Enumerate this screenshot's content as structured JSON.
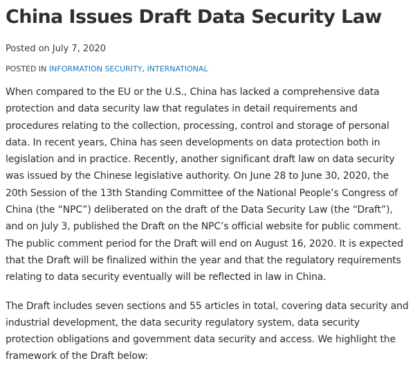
{
  "article": {
    "title": "China Issues Draft Data Security Law",
    "posted_on": "Posted on July 7, 2020",
    "posted_in_prefix": "POSTED IN ",
    "categories": [
      {
        "label": "INFORMATION SECURITY"
      },
      {
        "label": "INTERNATIONAL"
      }
    ],
    "category_separator": ", ",
    "paragraphs": [
      "When compared to the EU or the U.S., China has lacked a comprehensive data protection and data security law that regulates in detail requirements and procedures relating to the collection, processing, control and storage of personal data. In recent years, China has seen developments on data protection both in legislation and in practice. Recently, another significant draft law on data security was issued by the Chinese legislative authority. On June 28 to June 30, 2020, the 20th Session of the 13th Standing Committee of the National People’s Congress of China (the “NPC”) deliberated on the draft of the Data Security Law (the “Draft”), and on July 3, published the Draft on the NPC’s official website for public comment. The public comment period for the Draft will end on August 16, 2020. It is expected that the Draft will be finalized within the year and that the regulatory requirements relating to data security eventually will be reflected in law in China.",
      "The Draft includes seven sections and 55 articles in total, covering data security and industrial development, the data security regulatory system, data security protection obligations and government data security and access. We highlight the framework of the Draft below:"
    ]
  },
  "colors": {
    "link": "#1a77b8",
    "text": "#2b2b2b",
    "background": "#ffffff"
  }
}
